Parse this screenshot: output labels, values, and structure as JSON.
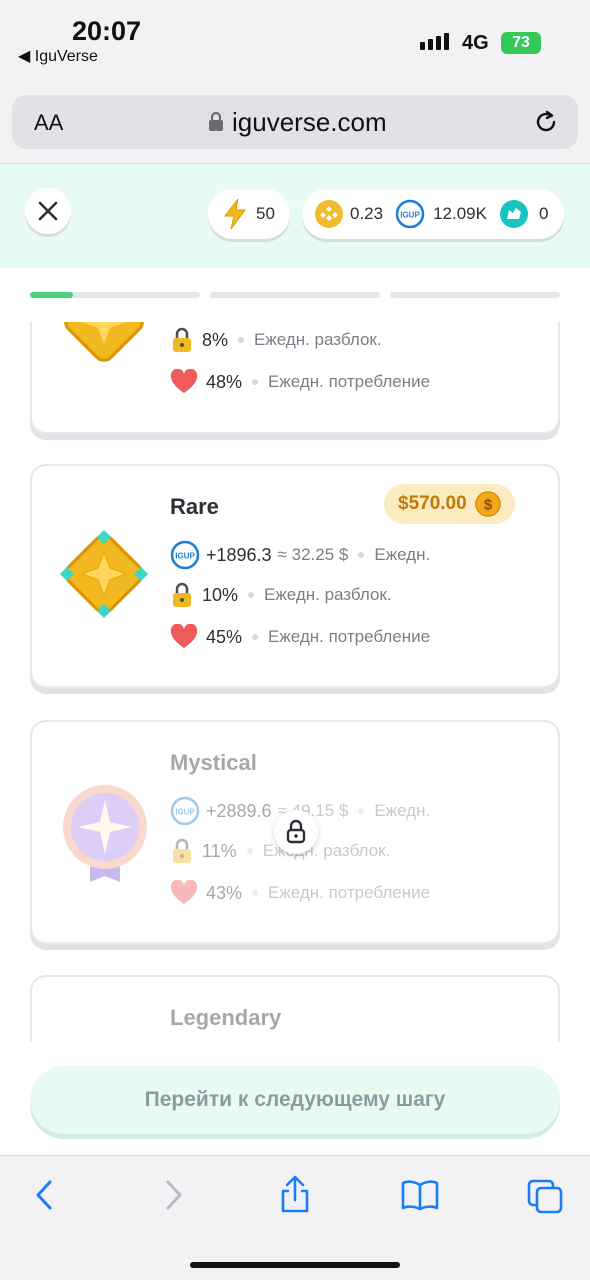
{
  "status_bar": {
    "time": "20:07",
    "back_app": "◀ IguVerse",
    "network": "4G",
    "battery": "73"
  },
  "browser": {
    "text_size_label": "AA",
    "url": "iguverse.com"
  },
  "header": {
    "energy": "50",
    "bnb_balance": "0.23",
    "igup_balance": "12.09K",
    "token_balance": "0"
  },
  "progress": [
    0.25,
    0,
    0
  ],
  "cards": [
    {
      "name": "",
      "unlock_value": "8%",
      "unlock_label": "Ежедн. разблок.",
      "consumption_value": "48%",
      "consumption_label": "Ежедн. потребление"
    },
    {
      "name": "Rare",
      "price": "$570.00",
      "income_value": "+1896.3",
      "income_usd": "≈ 32.25 $",
      "income_label": "Ежедн.",
      "unlock_value": "10%",
      "unlock_label": "Ежедн. разблок.",
      "consumption_value": "45%",
      "consumption_label": "Ежедн. потребление"
    },
    {
      "name": "Mystical",
      "income_value": "+2889.6",
      "income_usd": "≈ 49.15 $",
      "income_label": "Ежедн.",
      "unlock_value": "11%",
      "unlock_label": "Ежедн. разблок.",
      "consumption_value": "43%",
      "consumption_label": "Ежедн. потребление"
    },
    {
      "name": "Legendary"
    }
  ],
  "next_button": "Перейти к следующему шагу",
  "icons": {
    "igup_label": "IGUP",
    "colors": {
      "accent_green": "#4cd37f",
      "gold": "#f2b820",
      "mint_bg": "#e8fbf3"
    }
  }
}
